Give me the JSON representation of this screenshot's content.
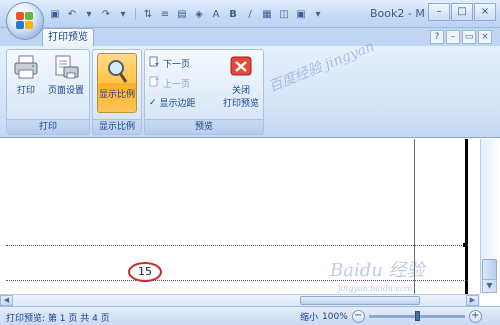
{
  "window": {
    "title": "Book2 - M",
    "controls": [
      "–",
      "□",
      "×"
    ]
  },
  "qat_icons": [
    "save-icon",
    "undo-icon",
    "redo-icon",
    "sort-icon",
    "align-icon",
    "format-icon",
    "fill-color-icon",
    "font-color-icon",
    "bold-icon",
    "link-icon",
    "chart-icon",
    "table-icon",
    "dropdown-icon"
  ],
  "tabs": {
    "active": "打印预览"
  },
  "groups": {
    "print": {
      "label": "打印",
      "print_button": "打印",
      "page_setup_button": "页面设置"
    },
    "zoom": {
      "label": "显示比例",
      "zoom_button": "显示比例"
    },
    "preview": {
      "label": "预览",
      "next_page": "下一页",
      "prev_page": "上一页",
      "show_margins": "显示边距",
      "show_margins_checked": true,
      "close_button_line1": "关闭",
      "close_button_line2": "打印预览"
    }
  },
  "document": {
    "page_number": "15"
  },
  "status": {
    "text": "打印预览: 第 1 页  共 4 页",
    "zoom_label": "缩小",
    "zoom_percent": "100%",
    "zoom_minus": "−",
    "zoom_plus": "+"
  },
  "watermarks": {
    "ribbon": "百度经验 jingyan",
    "doc": "Baidu 经验",
    "doc_url": "jingyan.baidu.com"
  },
  "colors": {
    "accent": "#ffc34a",
    "circle": "#c92b2b",
    "ribbon_text": "#15428b"
  }
}
